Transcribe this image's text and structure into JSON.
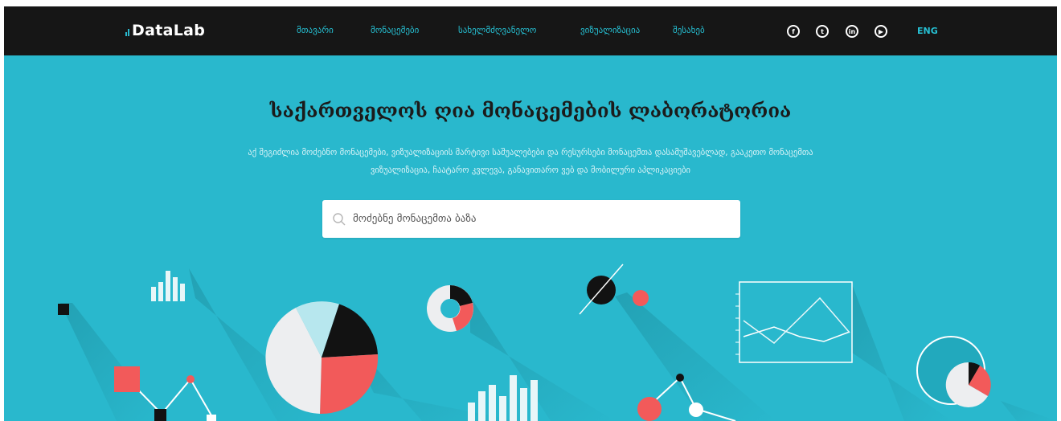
{
  "header": {
    "logo_text": "DataLab",
    "nav": [
      {
        "label": "მთავარი"
      },
      {
        "label": "მონაცემები"
      },
      {
        "label": "სახელმძღვანელო"
      },
      {
        "label": "ვიზუალიზაცია"
      },
      {
        "label": "შესახებ"
      }
    ],
    "social": [
      {
        "icon": "facebook-icon",
        "glyph": "f"
      },
      {
        "icon": "twitter-icon",
        "glyph": "t"
      },
      {
        "icon": "linkedin-icon",
        "glyph": "in"
      },
      {
        "icon": "youtube-icon",
        "glyph": "▶"
      }
    ],
    "lang": "ENG"
  },
  "hero": {
    "title": "საქართველოს ღია მონაცემების ლაბორატორია",
    "subtitle_line1": "აქ შეგიძლია მოძებნო მონაცემები, ვიზუალიზაციის მარტივი საშუალებები და რესურსები მონაცემთა დასამუშავებლად, გააკეთო მონაცემთა",
    "subtitle_line2": "ვიზუალიზაცია, ჩაატარო კვლევა, განავითარო ვებ და მობილური აპლიკაციები",
    "search_placeholder": "მოძებნე მონაცემთა ბაზა"
  },
  "colors": {
    "nav_bg": "#161616",
    "accent": "#29b8cd",
    "red": "#f25a5a",
    "light": "#edeef0"
  }
}
